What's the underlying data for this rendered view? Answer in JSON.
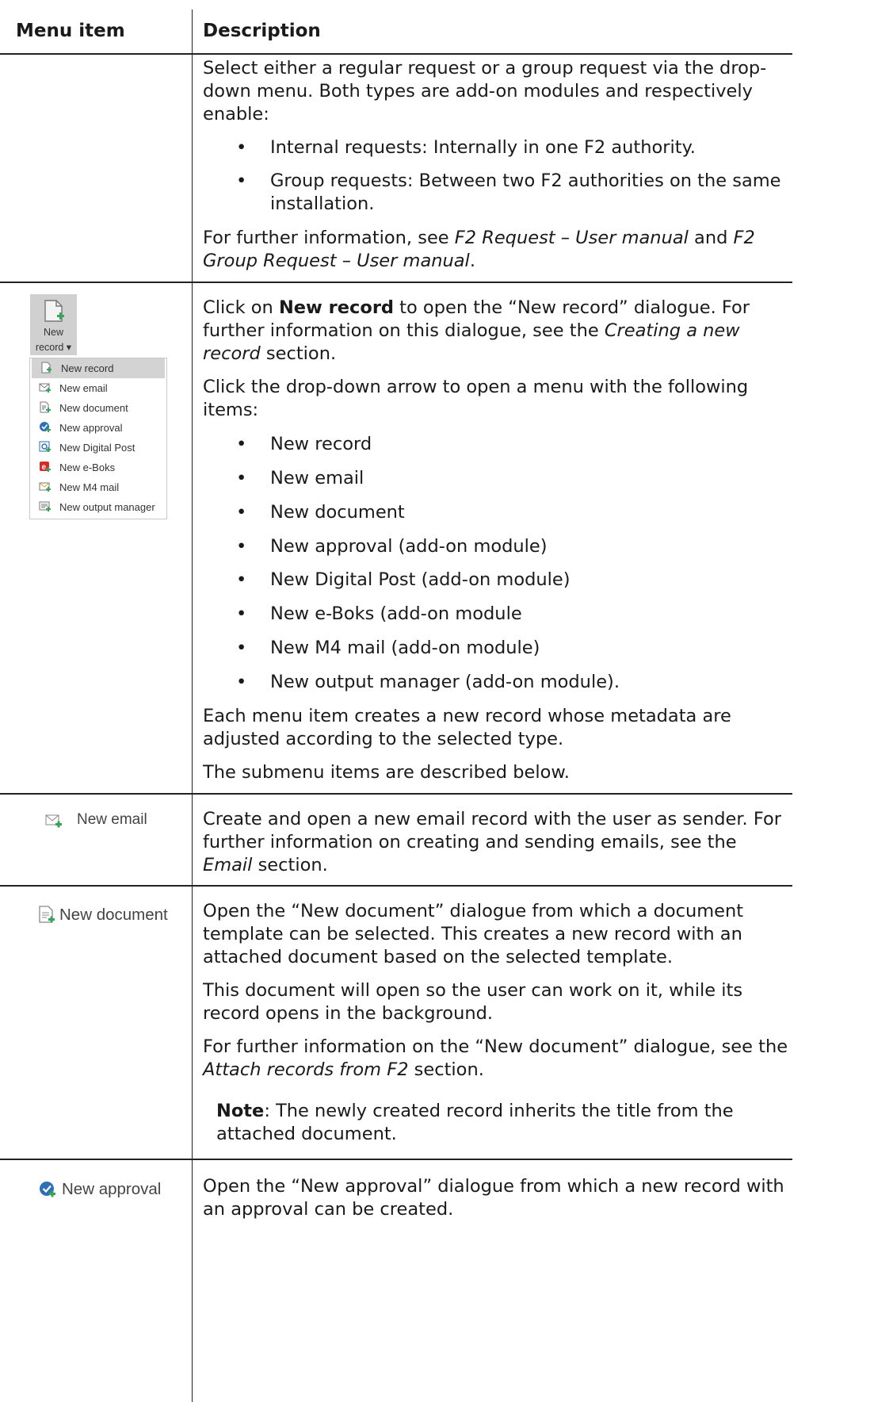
{
  "header": {
    "menu_item": "Menu item",
    "description": "Description"
  },
  "row1": {
    "intro": "Select either a regular request or a group request via the drop-down menu. Both types are add-on modules and respectively enable:",
    "bullets": [
      "Internal requests: Internally in one F2 authority.",
      "Group requests: Between two F2 authorities on the same installation."
    ],
    "further_a": "For further information, see ",
    "further_link1": "F2 Request – User manual",
    "further_b": " and ",
    "further_link2": "F2 Group Request – User manual",
    "further_c": "."
  },
  "row2": {
    "ribbon_button": {
      "line1": "New",
      "line2": "record ▾",
      "icon": "new-record-icon"
    },
    "menu_items": [
      {
        "label": "New record",
        "icon": "new-record-icon"
      },
      {
        "label": "New email",
        "icon": "email-icon"
      },
      {
        "label": "New document",
        "icon": "document-icon"
      },
      {
        "label": "New approval",
        "icon": "approval-icon"
      },
      {
        "label": "New Digital Post",
        "icon": "digital-post-icon"
      },
      {
        "label": "New e-Boks",
        "icon": "e-boks-icon"
      },
      {
        "label": "New M4 mail",
        "icon": "m4-mail-icon"
      },
      {
        "label": "New output manager",
        "icon": "output-manager-icon"
      }
    ],
    "p1_a": "Click on ",
    "p1_bold": "New record",
    "p1_b": " to open the “New record” dialogue. For further information on this dialogue, see the ",
    "p1_link": "Creating a new record",
    "p1_c": " section.",
    "p2": "Click the drop-down arrow to open a menu with the following items:",
    "bullets": [
      "New record",
      "New email",
      "New document",
      "New approval (add-on module)",
      "New Digital Post (add-on module)",
      "New e-Boks (add-on module",
      "New M4 mail (add-on module)",
      "New output manager (add-on module)."
    ],
    "p3": "Each menu item creates a new record whose metadata are adjusted according to the selected type.",
    "p4": "The submenu items are described below."
  },
  "row3": {
    "label": "New email",
    "p_a": "Create and open a new email record with the user as sender. For further information on creating and sending emails, see the ",
    "p_link": "Email",
    "p_b": " section."
  },
  "row4": {
    "label": "New document",
    "p1": "Open the “New document” dialogue from which a document template can be selected. This creates a new record with an attached document based on the selected template.",
    "p2": "This document will open so the user can work on it, while its record opens in the background.",
    "p3_a": "For further information on the “New document” dialogue, see the ",
    "p3_link": "Attach records from F2",
    "p3_b": " section.",
    "note_bold": "Note",
    "note_text": ": The newly created record inherits the title from the attached document."
  },
  "row5": {
    "label": "New approval",
    "p": "Open the “New approval” dialogue from which a new record with an approval can be created."
  },
  "colors": {
    "rule": "#222222",
    "menu_selected": "#d3d3d3",
    "ribbon_button": "#d0d0d0",
    "plus_green": "#3aa35a"
  }
}
